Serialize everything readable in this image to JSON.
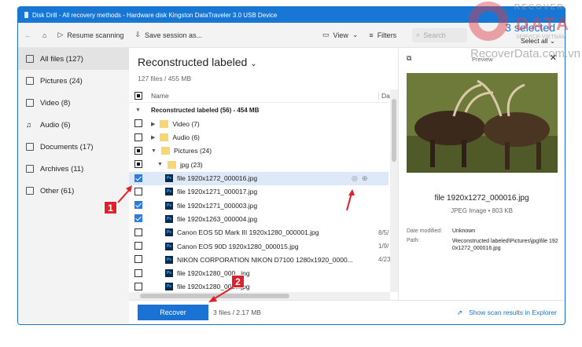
{
  "window": {
    "title": "Disk Drill - All recovery methods - Hardware disk Kingston DataTraveler 3.0 USB Device"
  },
  "toolbar": {
    "resume": "Resume scanning",
    "save": "Save session as...",
    "view": "View",
    "filters": "Filters",
    "search_placeholder": "Search",
    "more": "..."
  },
  "sidebar": {
    "items": [
      {
        "label": "All files (127)"
      },
      {
        "label": "Pictures (24)"
      },
      {
        "label": "Video (8)"
      },
      {
        "label": "Audio (6)"
      },
      {
        "label": "Documents (17)"
      },
      {
        "label": "Archives (11)"
      },
      {
        "label": "Other (61)"
      }
    ]
  },
  "main": {
    "title": "Reconstructed labeled",
    "subtitle": "127 files / 455 MB",
    "selected": "3 selected",
    "select_all": "Select all"
  },
  "table": {
    "col_name": "Name",
    "col_date": "Date",
    "rows": [
      {
        "name": "Reconstructed labeled (56) - 454 MB",
        "date": ""
      },
      {
        "name": "Video (7)",
        "date": ""
      },
      {
        "name": "Audio (6)",
        "date": ""
      },
      {
        "name": "Pictures (24)",
        "date": ""
      },
      {
        "name": "jpg (23)",
        "date": ""
      },
      {
        "name": "file 1920x1272_000016.jpg",
        "date": ""
      },
      {
        "name": "file 1920x1271_000017.jpg",
        "date": ""
      },
      {
        "name": "file 1920x1271_000003.jpg",
        "date": ""
      },
      {
        "name": "file 1920x1263_000004.jpg",
        "date": ""
      },
      {
        "name": "Canon EOS 5D Mark III 1920x1280_000001.jpg",
        "date": "8/5/"
      },
      {
        "name": "Canon EOS 90D 1920x1280_000015.jpg",
        "date": "1/9/"
      },
      {
        "name": "NIKON CORPORATION NIKON D7100 1280x1920_0000...",
        "date": "4/23"
      },
      {
        "name": "file 1920x1280_000...jpg",
        "date": ""
      },
      {
        "name": "file 1920x1280_000...jpg",
        "date": ""
      }
    ]
  },
  "preview": {
    "label": "Preview",
    "filename": "file 1920x1272_000016.jpg",
    "type": "JPEG Image • 803 KB",
    "date_label": "Date modified:",
    "date_value": "Unknown",
    "path_label": "Path:",
    "path_value": "\\Reconstructed labeled\\Pictures\\jpg\\file 1920x1272_000016.jpg"
  },
  "bottom": {
    "recover": "Recover",
    "summary": "3 files / 2.17 MB",
    "explorer": "Show scan results in Explorer"
  },
  "annotations": {
    "one": "1",
    "two": "2"
  },
  "watermark": {
    "line1": "RECOVER",
    "line2": "DATA",
    "line3": "SERVICE-VIETNAM",
    "line4": "RecoverData.com.vn"
  },
  "colors": {
    "accent": "#1a73d4",
    "annotation": "#e0202a"
  }
}
